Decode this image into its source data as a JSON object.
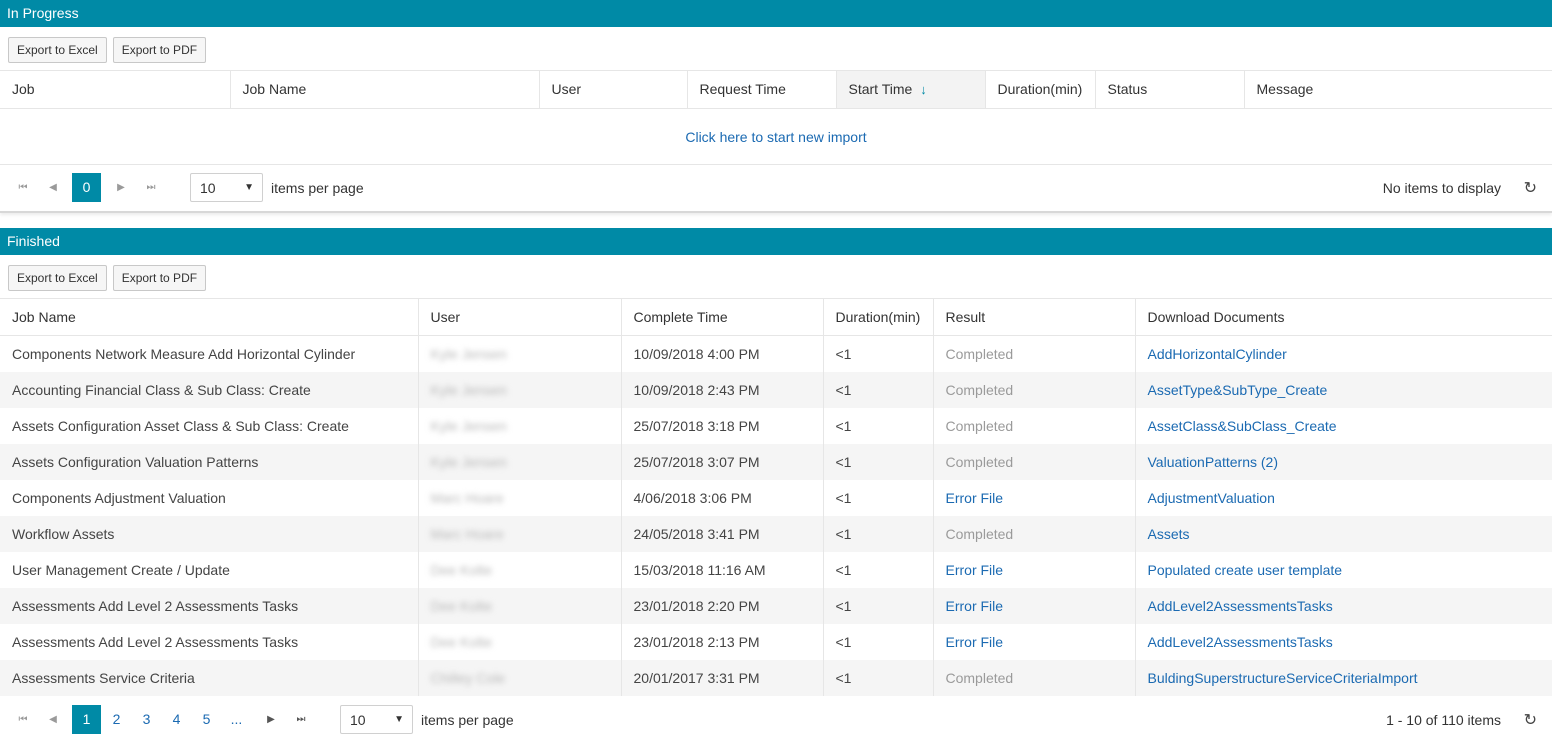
{
  "in_progress": {
    "title": "In Progress",
    "export_excel": "Export to Excel",
    "export_pdf": "Export to PDF",
    "columns": [
      "Job",
      "Job Name",
      "User",
      "Request Time",
      "Start Time",
      "Duration(min)",
      "Status",
      "Message"
    ],
    "sort_arrow": "↓",
    "empty_message": "Click here to start new import",
    "pager": {
      "current_page": "0",
      "page_size": "10",
      "items_per_page_label": "items per page",
      "info": "No items to display"
    }
  },
  "finished": {
    "title": "Finished",
    "export_excel": "Export to Excel",
    "export_pdf": "Export to PDF",
    "columns": [
      "Job Name",
      "User",
      "Complete Time",
      "Duration(min)",
      "Result",
      "Download Documents"
    ],
    "rows": [
      {
        "job_name": "Components Network Measure Add Horizontal Cylinder",
        "user": "Kyle Jensen",
        "complete_time": "10/09/2018 4:00 PM",
        "duration": "<1",
        "result": "Completed",
        "download": "AddHorizontalCylinder"
      },
      {
        "job_name": "Accounting Financial Class & Sub Class: Create",
        "user": "Kyle Jensen",
        "complete_time": "10/09/2018 2:43 PM",
        "duration": "<1",
        "result": "Completed",
        "download": "AssetType&SubType_Create"
      },
      {
        "job_name": "Assets Configuration Asset Class & Sub Class: Create",
        "user": "Kyle Jensen",
        "complete_time": "25/07/2018 3:18 PM",
        "duration": "<1",
        "result": "Completed",
        "download": "AssetClass&SubClass_Create"
      },
      {
        "job_name": "Assets Configuration Valuation Patterns",
        "user": "Kyle Jensen",
        "complete_time": "25/07/2018 3:07 PM",
        "duration": "<1",
        "result": "Completed",
        "download": "ValuationPatterns (2)"
      },
      {
        "job_name": "Components Adjustment Valuation",
        "user": "Marc Hoare",
        "complete_time": "4/06/2018 3:06 PM",
        "duration": "<1",
        "result": "Error File",
        "download": "AdjustmentValuation"
      },
      {
        "job_name": "Workflow Assets",
        "user": "Marc Hoare",
        "complete_time": "24/05/2018 3:41 PM",
        "duration": "<1",
        "result": "Completed",
        "download": "Assets"
      },
      {
        "job_name": "User Management Create / Update",
        "user": "Dee Kolte",
        "complete_time": "15/03/2018 11:16 AM",
        "duration": "<1",
        "result": "Error File",
        "download": "Populated create user template"
      },
      {
        "job_name": "Assessments Add Level 2 Assessments Tasks",
        "user": "Dee Kolte",
        "complete_time": "23/01/2018 2:20 PM",
        "duration": "<1",
        "result": "Error File",
        "download": "AddLevel2AssessmentsTasks"
      },
      {
        "job_name": "Assessments Add Level 2 Assessments Tasks",
        "user": "Dee Kolte",
        "complete_time": "23/01/2018 2:13 PM",
        "duration": "<1",
        "result": "Error File",
        "download": "AddLevel2AssessmentsTasks"
      },
      {
        "job_name": "Assessments Service Criteria",
        "user": "Chilley Cole",
        "complete_time": "20/01/2017 3:31 PM",
        "duration": "<1",
        "result": "Completed",
        "download": "BuldingSuperstructureServiceCriteriaImport"
      }
    ],
    "pager": {
      "pages": [
        "1",
        "2",
        "3",
        "4",
        "5",
        "..."
      ],
      "current_page": "1",
      "page_size": "10",
      "items_per_page_label": "items per page",
      "info": "1 - 10 of 110 items"
    }
  },
  "icons": {
    "first": "first-page-icon",
    "prev": "prev-page-icon",
    "next": "next-page-icon",
    "last": "last-page-icon",
    "refresh": "refresh-icon",
    "dropdown": "chevron-down-icon"
  },
  "colors": {
    "header_bg": "#008aa6",
    "link": "#1b6ab2",
    "muted": "#9a9a9a"
  }
}
